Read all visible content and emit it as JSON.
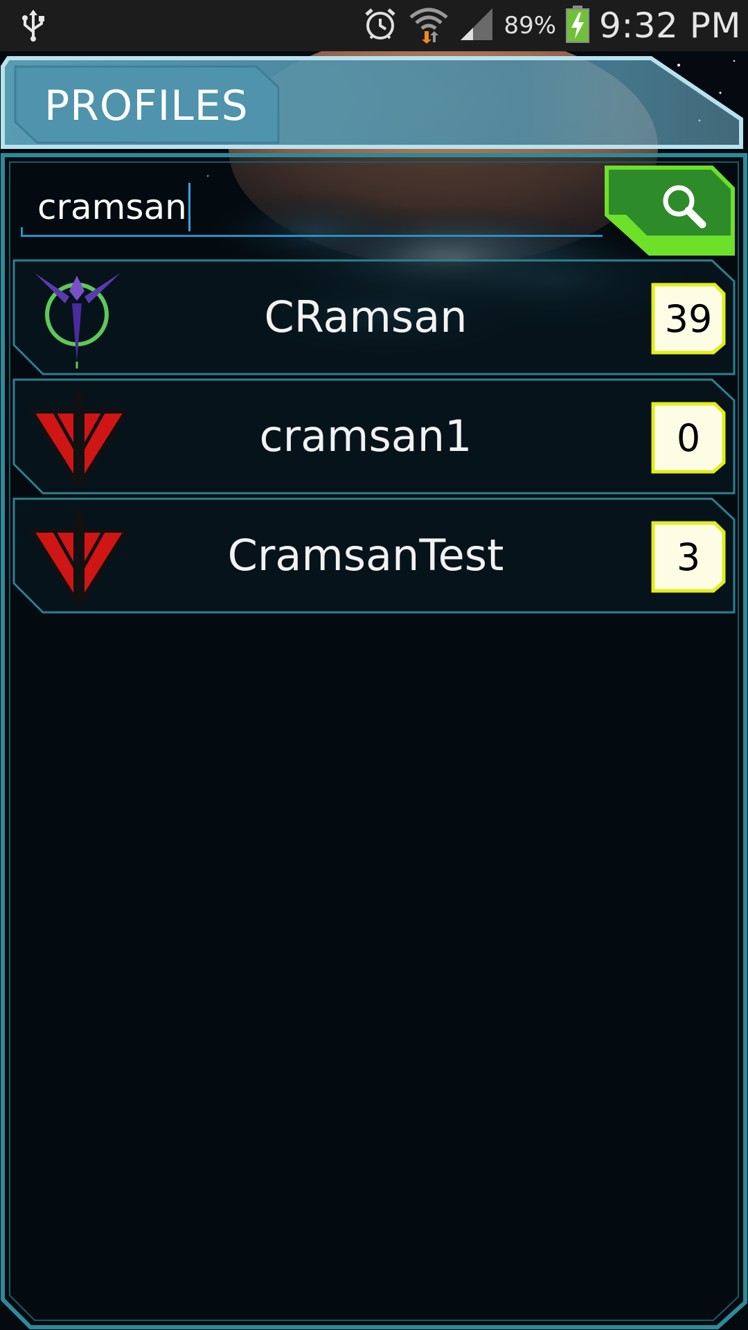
{
  "status_bar": {
    "battery_percent": "89%",
    "time": "9:32 PM",
    "icons": [
      "usb-icon",
      "alarm-icon",
      "wifi-icon",
      "signal-icon",
      "battery-charging-icon"
    ]
  },
  "header": {
    "title": "PROFILES"
  },
  "search": {
    "value": "cramsan",
    "button_icon": "search-icon"
  },
  "profiles": [
    {
      "name": "CRamsan",
      "level": "39",
      "faction_icon": "resistance-faction-icon"
    },
    {
      "name": "cramsan1",
      "level": "0",
      "faction_icon": "red-faction-icon"
    },
    {
      "name": "CramsanTest",
      "level": "3",
      "faction_icon": "red-faction-icon"
    }
  ],
  "colors": {
    "header_blue": "#4f93ad",
    "frame_teal": "#2e8a99",
    "search_green": "#2e8b2a",
    "search_green_light": "#6de02a",
    "level_badge_fill": "#fdfde6",
    "level_badge_border": "#e3ee1a",
    "panel_dark": "#06121a"
  }
}
